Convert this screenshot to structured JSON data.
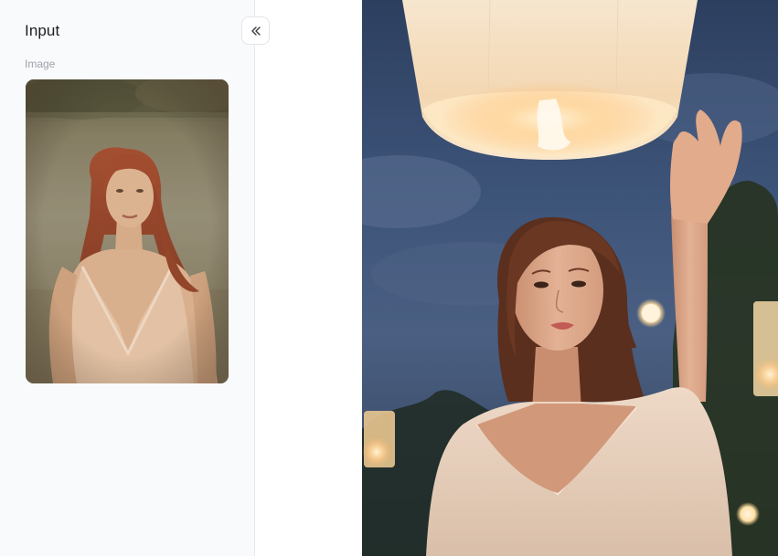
{
  "panel": {
    "title": "Input",
    "collapse_icon": "chevrons-left-icon",
    "image_field_label": "Image"
  },
  "colors": {
    "panel_bg": "#f9fafc",
    "border": "#e6e8ec",
    "title_text": "#1d1f24",
    "label_text": "#9ca1ab"
  }
}
